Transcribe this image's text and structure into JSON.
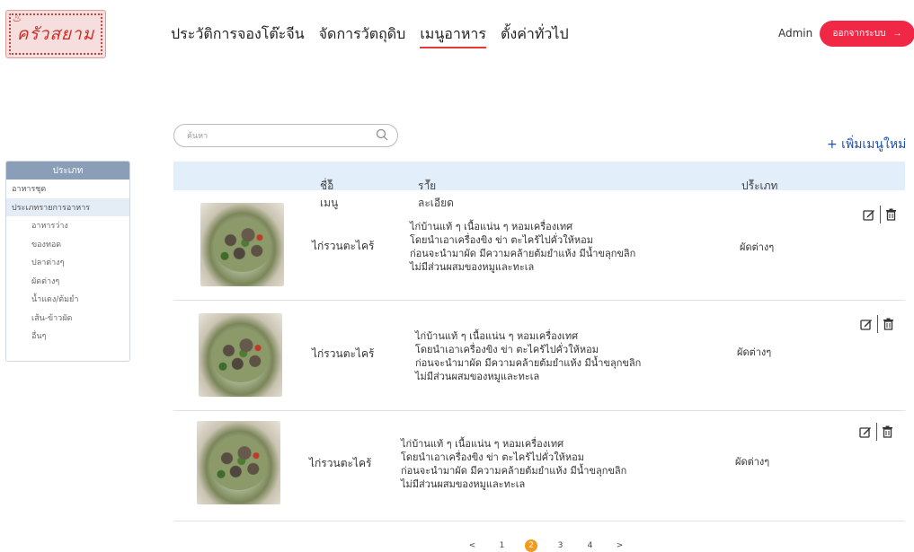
{
  "brand": {
    "logo_text": "ครัวสยาม"
  },
  "nav": {
    "items": [
      "ประวัติการจองโต๊ะจีน",
      "จัดการวัตถุดิบ",
      "เมนูอาหาร",
      "ตั้งค่าทั่วไป"
    ],
    "active_index": 2
  },
  "user": {
    "name": "Admin",
    "logout_label": "ออกจากระบบ"
  },
  "search": {
    "placeholder": "ค้นหา"
  },
  "add_button": {
    "label": "+ เพิ่มเมนูใหม่"
  },
  "sidebar": {
    "header": "ประเภท",
    "items": [
      {
        "label": "อาหารชุด",
        "sub": false,
        "selected": false
      },
      {
        "label": "ประเภทรายการอาหาร",
        "sub": false,
        "selected": true
      },
      {
        "label": "อาหารว่าง",
        "sub": true,
        "selected": false
      },
      {
        "label": "ของทอด",
        "sub": true,
        "selected": false
      },
      {
        "label": "ปลาต่างๆ",
        "sub": true,
        "selected": false
      },
      {
        "label": "ผัดต่างๆ",
        "sub": true,
        "selected": false
      },
      {
        "label": "น้ำแดง/ต้มยำ",
        "sub": true,
        "selected": false
      },
      {
        "label": "เส้น-ข้าวผัด",
        "sub": true,
        "selected": false
      },
      {
        "label": "อื่นๆ",
        "sub": true,
        "selected": false
      }
    ]
  },
  "table": {
    "columns": [
      "ชื่อเมนู",
      "รายละเอียด",
      "ประเภท"
    ],
    "rows": [
      {
        "name": "ไก่รวนตะไคร้",
        "desc": [
          "ไก่บ้านแท้ ๆ เนื้อแน่น ๆ หอมเครื่องเทศ",
          "โดยนำเอาเครื่องขิง ข่า ตะไคร้ไปคั่วให้หอม",
          "ก่อนจะนำมาผัด มีความคล้ายต้มยำแห้ง มีน้ำขลุกขลิก",
          "ไม่มีส่วนผสมของหมูและทะเล"
        ],
        "category": "ผัดต่างๆ"
      },
      {
        "name": "ไก่รวนตะไคร้",
        "desc": [
          "ไก่บ้านแท้ ๆ เนื้อแน่น ๆ หอมเครื่องเทศ",
          "โดยนำเอาเครื่องขิง ข่า ตะไคร้ไปคั่วให้หอม",
          "ก่อนจะนำมาผัด มีความคล้ายต้มยำแห้ง มีน้ำขลุกขลิก",
          "ไม่มีส่วนผสมของหมูและทะเล"
        ],
        "category": "ผัดต่างๆ"
      },
      {
        "name": "ไก่รวนตะไคร้",
        "desc": [
          "ไก่บ้านแท้ ๆ เนื้อแน่น ๆ หอมเครื่องเทศ",
          "โดยนำเอาเครื่องขิง ข่า ตะไคร้ไปคั่วให้หอม",
          "ก่อนจะนำมาผัด มีความคล้ายต้มยำแห้ง มีน้ำขลุกขลิก",
          "ไม่มีส่วนผสมของหมูและทะเล"
        ],
        "category": "ผัดต่างๆ"
      }
    ]
  },
  "pagination": {
    "prev": "<",
    "pages": [
      "1",
      "2",
      "3",
      "4"
    ],
    "current": "2",
    "next": ">"
  },
  "colors": {
    "accent": "#f02845",
    "link": "#1c4fb8",
    "header_bg": "#e3eefb",
    "page_active": "#f39a1c"
  }
}
